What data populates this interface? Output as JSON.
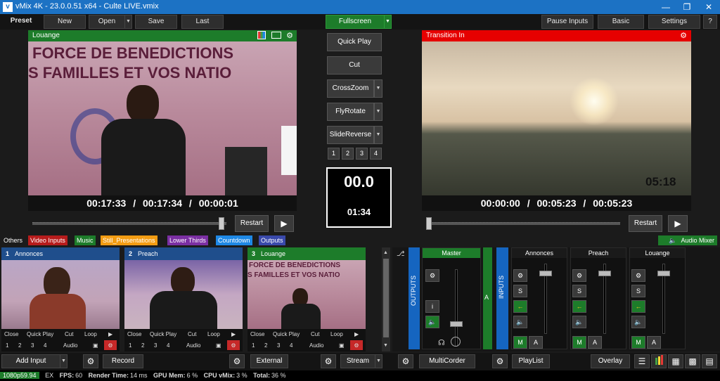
{
  "window": {
    "title": "vMix 4K - 23.0.0.51 x64 - Culte LIVE.vmix"
  },
  "toolbar": {
    "preset": "Preset",
    "new": "New",
    "open": "Open",
    "save": "Save",
    "last": "Last",
    "fullscreen": "Fullscreen",
    "pause_inputs": "Pause Inputs",
    "basic": "Basic",
    "settings": "Settings",
    "help": "?"
  },
  "preview": {
    "title": "Louange",
    "banner_line1": "FORCE DE BENEDICTIONS",
    "banner_line2": "S FAMILLES ET VOS NATIO",
    "time_current": "00:17:33",
    "time_total": "00:17:34",
    "time_remaining": "00:00:01",
    "sep": "/",
    "restart": "Restart",
    "position": 0.99
  },
  "output": {
    "title": "Transition In",
    "overlay_time": "05:18",
    "time_current": "00:00:00",
    "time_total": "00:05:23",
    "time_remaining": "00:05:23",
    "sep": "/",
    "restart": "Restart",
    "position": 0.0
  },
  "transitions": {
    "quick_play": "Quick Play",
    "cut": "Cut",
    "t1": "CrossZoom",
    "t2": "FlyRotate",
    "t3": "SlideReverse",
    "nums": [
      "1",
      "2",
      "3",
      "4"
    ],
    "counter_main": "00.0",
    "counter_sub": "01:34"
  },
  "tabs": [
    {
      "label": "Others",
      "color": "#1b1b1b"
    },
    {
      "label": "Video Inputs",
      "color": "#b71c1c"
    },
    {
      "label": "Music",
      "color": "#1d7c2a"
    },
    {
      "label": "Still_Presentations",
      "color": "#f39c12"
    },
    {
      "label": "Lower Thirds",
      "color": "#7b2fa3"
    },
    {
      "label": "Countdown",
      "color": "#1e88e5"
    },
    {
      "label": "Outputs",
      "color": "#3949ab"
    }
  ],
  "audio_mixer_label": "Audio Mixer",
  "inputs": [
    {
      "num": "1",
      "name": "Annonces",
      "hdr_color": "#1f4e8c"
    },
    {
      "num": "2",
      "name": "Preach",
      "hdr_color": "#1f4e8c"
    },
    {
      "num": "3",
      "name": "Louange",
      "hdr_color": "#1d7c2a"
    }
  ],
  "input_row": {
    "close": "Close",
    "quick_play": "Quick Play",
    "cut": "Cut",
    "loop": "Loop",
    "nums": [
      "1",
      "2",
      "3",
      "4"
    ],
    "audio": "Audio"
  },
  "mixer": {
    "outputs_label": "OUTPUTS",
    "master": "Master",
    "a_label": "A",
    "inputs_label": "INPUTS",
    "channels": [
      "Annonces",
      "Preach",
      "Louange"
    ],
    "i_label": "i",
    "s_label": "S",
    "m_label": "M",
    "a_btn": "A"
  },
  "bottom": {
    "add_input": "Add Input",
    "record": "Record",
    "external": "External",
    "stream": "Stream",
    "multicorder": "MultiCorder",
    "playlist": "PlayList",
    "overlay": "Overlay"
  },
  "status": {
    "format": "1080p59.94",
    "ex": "EX",
    "fps_label": "FPS:",
    "fps": "60",
    "render_label": "Render Time:",
    "render": "14 ms",
    "gpu_label": "GPU Mem:",
    "gpu": "6 %",
    "cpu_label": "CPU vMix:",
    "cpu": "3 %",
    "total_label": "Total:",
    "total": "36 %"
  }
}
